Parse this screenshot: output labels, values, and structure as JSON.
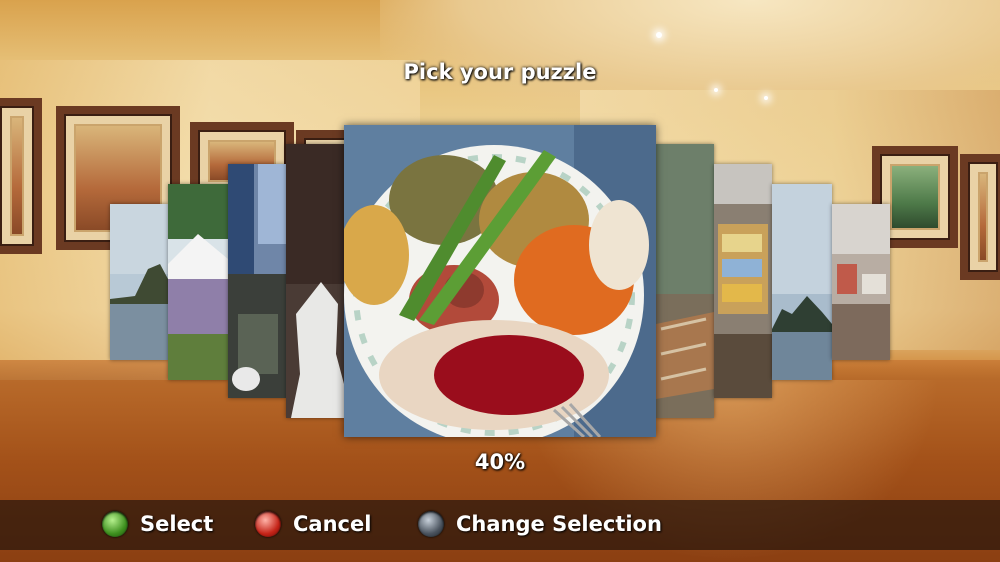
{
  "screen": {
    "title": "Pick your puzzle",
    "progress_label": "40%",
    "progress_value": 0.4
  },
  "tiles": [
    {
      "subject": "coastal-lake-photo"
    },
    {
      "subject": "lavender-field-photo"
    },
    {
      "subject": "city-buildings-photo"
    },
    {
      "subject": "dragon-statue-photo"
    },
    {
      "subject": "thanksgiving-dinner-plate-photo",
      "selected": true
    },
    {
      "subject": "backyard-fence-photo"
    },
    {
      "subject": "store-shelf-photo"
    },
    {
      "subject": "island-lake-photo"
    },
    {
      "subject": "cluttered-room-photo"
    }
  ],
  "controls": [
    {
      "button": "green",
      "label": "Select"
    },
    {
      "button": "red",
      "label": "Cancel"
    },
    {
      "button": "dark",
      "label": "Change Selection"
    }
  ],
  "colors": {
    "select_button": "#3d8f1e",
    "cancel_button": "#c42317",
    "change_button": "#49525d"
  }
}
